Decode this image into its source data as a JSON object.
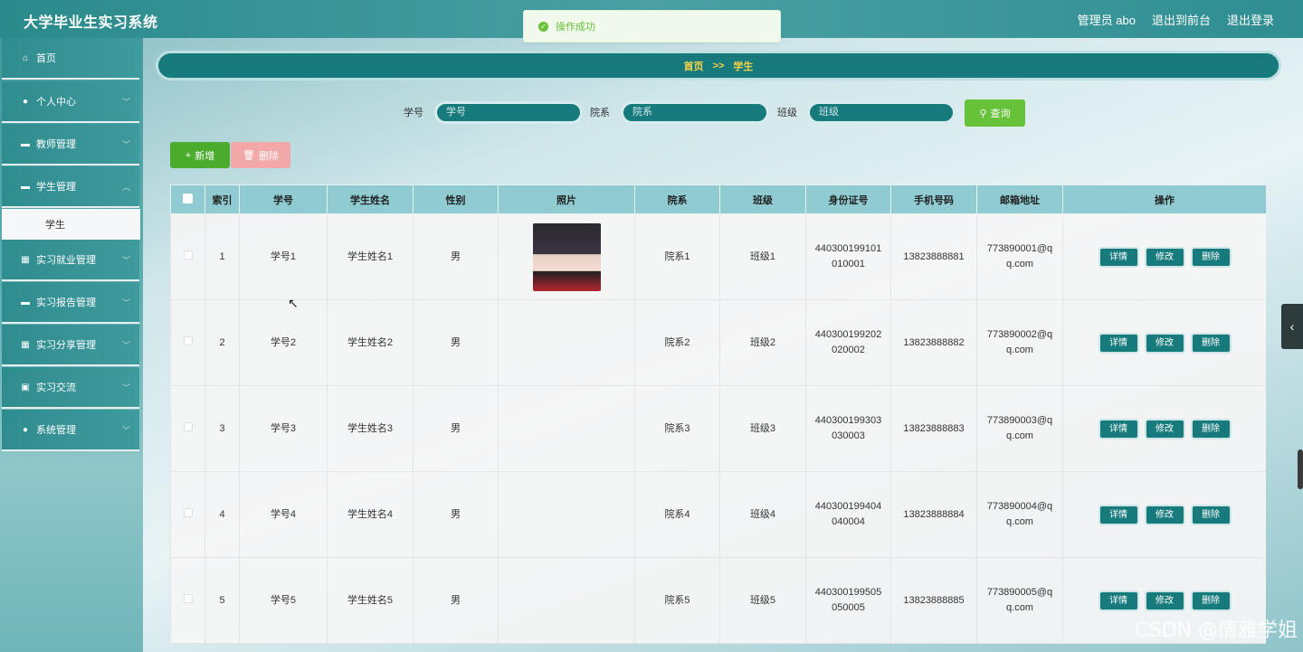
{
  "app": {
    "title": "大学毕业生实习系统"
  },
  "header": {
    "user_label": "管理员 abo",
    "front_label": "退出到前台",
    "logout_label": "退出登录"
  },
  "toast": {
    "message": "操作成功"
  },
  "sidebar": {
    "items": [
      {
        "label": "首页",
        "icon": "home-icon"
      },
      {
        "label": "个人中心",
        "icon": "user-icon"
      },
      {
        "label": "教师管理",
        "icon": "briefcase-icon"
      },
      {
        "label": "学生管理",
        "icon": "monitor-icon"
      },
      {
        "label": "实习就业管理",
        "icon": "grid-icon"
      },
      {
        "label": "实习报告管理",
        "icon": "chat-icon"
      },
      {
        "label": "实习分享管理",
        "icon": "grid-icon"
      },
      {
        "label": "实习交流",
        "icon": "clipboard-icon"
      },
      {
        "label": "系统管理",
        "icon": "location-icon"
      }
    ],
    "sub_item": "学生"
  },
  "breadcrumb": {
    "home": "首页",
    "sep": ">>",
    "current": "学生"
  },
  "search": {
    "fields": [
      {
        "label": "学号",
        "placeholder": "学号"
      },
      {
        "label": "院系",
        "placeholder": "院系"
      },
      {
        "label": "班级",
        "placeholder": "班级"
      }
    ],
    "button": "查询"
  },
  "actions": {
    "add": "新增",
    "delete": "删除"
  },
  "table": {
    "headers": [
      "索引",
      "学号",
      "学生姓名",
      "性别",
      "照片",
      "院系",
      "班级",
      "身份证号",
      "手机号码",
      "邮箱地址",
      "操作"
    ],
    "op_labels": {
      "detail": "详情",
      "edit": "修改",
      "delete": "删除"
    },
    "rows": [
      {
        "index": "1",
        "sid": "学号1",
        "name": "学生姓名1",
        "gender": "男",
        "dept": "院系1",
        "cls": "班级1",
        "idno1": "440300199101",
        "idno2": "010001",
        "phone": "13823888881",
        "email1": "773890001@q",
        "email2": "q.com"
      },
      {
        "index": "2",
        "sid": "学号2",
        "name": "学生姓名2",
        "gender": "男",
        "dept": "院系2",
        "cls": "班级2",
        "idno1": "440300199202",
        "idno2": "020002",
        "phone": "13823888882",
        "email1": "773890002@q",
        "email2": "q.com"
      },
      {
        "index": "3",
        "sid": "学号3",
        "name": "学生姓名3",
        "gender": "男",
        "dept": "院系3",
        "cls": "班级3",
        "idno1": "440300199303",
        "idno2": "030003",
        "phone": "13823888883",
        "email1": "773890003@q",
        "email2": "q.com"
      },
      {
        "index": "4",
        "sid": "学号4",
        "name": "学生姓名4",
        "gender": "男",
        "dept": "院系4",
        "cls": "班级4",
        "idno1": "440300199404",
        "idno2": "040004",
        "phone": "13823888884",
        "email1": "773890004@q",
        "email2": "q.com"
      },
      {
        "index": "5",
        "sid": "学号5",
        "name": "学生姓名5",
        "gender": "男",
        "dept": "院系5",
        "cls": "班级5",
        "idno1": "440300199505",
        "idno2": "050005",
        "phone": "13823888885",
        "email1": "773890005@q",
        "email2": "q.com"
      }
    ]
  },
  "watermark": "CSDN @倩雅学姐"
}
